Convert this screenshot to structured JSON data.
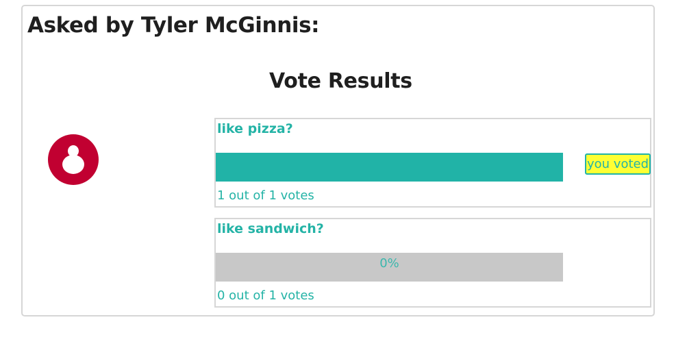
{
  "poll": {
    "asked_by": "Asked by Tyler McGinnis:",
    "results_title": "Vote Results",
    "avatar_icon": "user-silhouette-icon",
    "colors": {
      "accent": "#21b3a7",
      "avatar_bg": "#c10031",
      "track": "#c8c8c8",
      "badge_bg": "#ffff33"
    },
    "options": [
      {
        "text": "like pizza?",
        "percent": 100,
        "percent_label": "",
        "votes_text": "1 out of 1 votes",
        "voted_label": "you voted"
      },
      {
        "text": "like sandwich?",
        "percent": 0,
        "percent_label": "0%",
        "votes_text": "0 out of 1 votes",
        "voted_label": ""
      }
    ]
  }
}
